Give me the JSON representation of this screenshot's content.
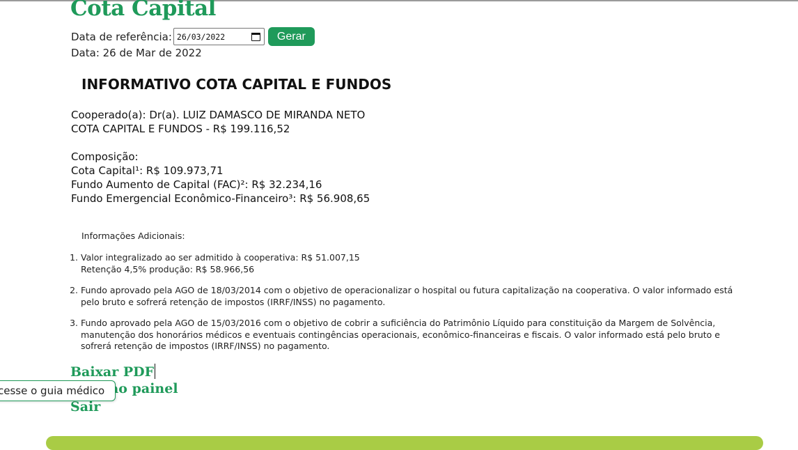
{
  "header": {
    "title": "Cota Capital"
  },
  "form": {
    "reference_label": "Data de referência:",
    "date_value": "26/03/2022",
    "button_label": "Gerar"
  },
  "data_line": "Data: 26 de Mar de 2022",
  "report": {
    "heading": "INFORMATIVO COTA CAPITAL E FUNDOS",
    "member": "Cooperado(a): Dr(a). LUIZ DAMASCO DE MIRANDA NETO",
    "total": "COTA CAPITAL E FUNDOS - R$ 199.116,52",
    "composition_label": "Composição:",
    "items": [
      "Cota Capital¹: R$ 109.973,71",
      "Fundo Aumento de Capital (FAC)²: R$ 32.234,16",
      "Fundo Emergencial Econômico-Financeiro³: R$ 56.908,65"
    ]
  },
  "additional": {
    "title": "Informações Adicionais:",
    "notes": [
      {
        "line1": "Valor integralizado ao ser admitido à cooperativa: R$ 51.007,15",
        "line2": "Retenção 4,5% produção: R$ 58.966,56"
      },
      {
        "line1": "Fundo aprovado pela AGO de 18/03/2014 com o objetivo de operacionalizar o hospital ou futura capitalização na cooperativa. O valor informado está pelo bruto e sofrerá retenção de impostos (IRRF/INSS) no pagamento.",
        "line2": ""
      },
      {
        "line1": "Fundo aprovado pela AGO de 15/03/2016 com o objetivo de cobrir a suficiência do Patrimônio Líquido para constituição da Margem de Solvência, manutenção dos honorários médicos e eventuais contingências operacionais, econômico-financeiras e fiscais. O valor informado está pelo bruto e sofrerá retenção de impostos (IRRF/INSS) no pagamento.",
        "line2": ""
      }
    ]
  },
  "links": {
    "download": "Baixar PDF",
    "back_panel": "ao painel",
    "logout": "Sair"
  },
  "floating_tab": {
    "label": "cesse o guia médico"
  },
  "colors": {
    "brand_green": "#1f9a5a",
    "bar_green": "#a9cc45"
  },
  "icons": {
    "date_picker": "calendar-icon"
  }
}
